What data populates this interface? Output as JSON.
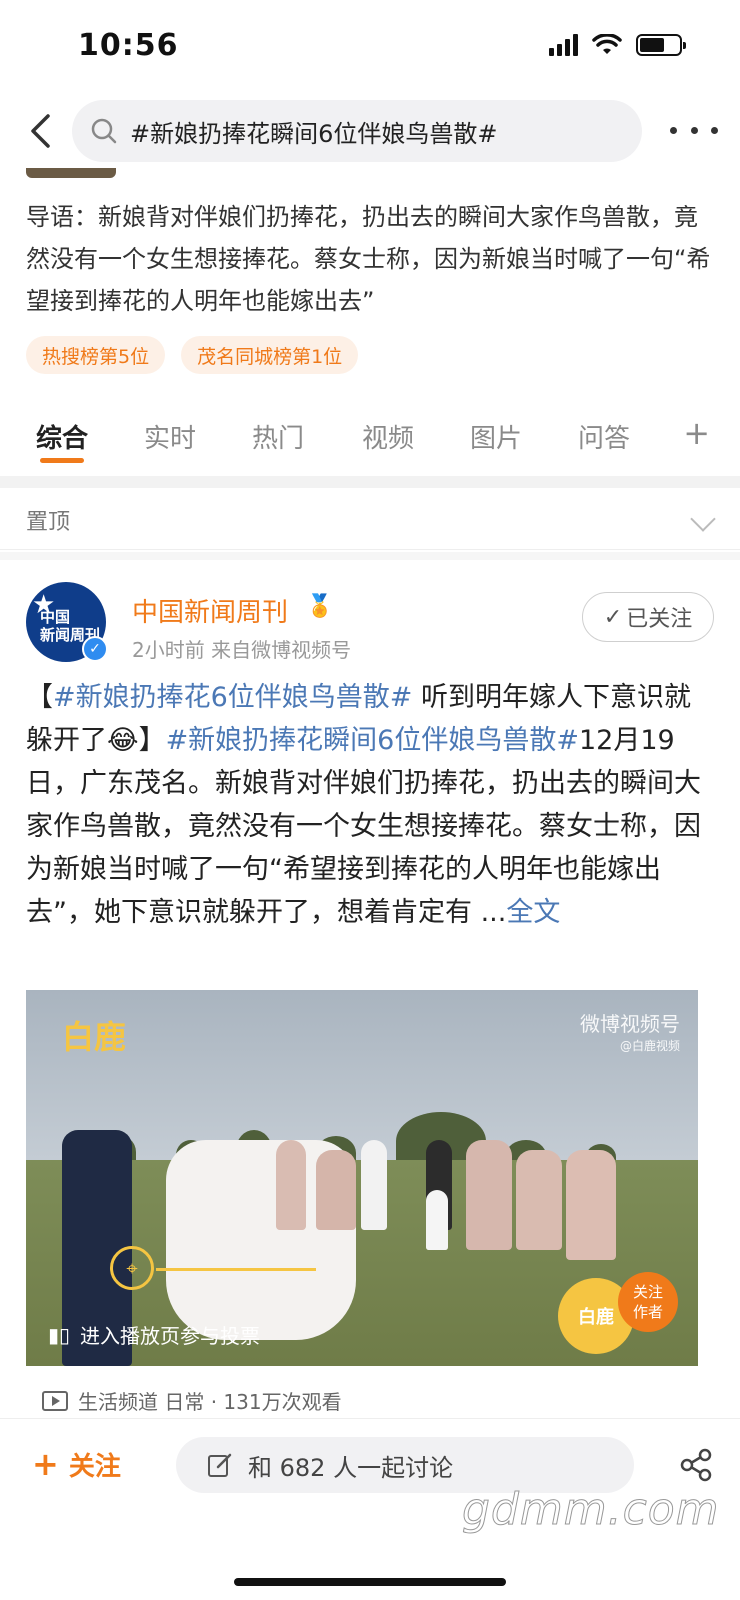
{
  "status_bar": {
    "time": "10:56"
  },
  "search": {
    "query": "#新娘扔捧花瞬间6位伴娘鸟兽散#"
  },
  "intro": {
    "text": "导语：新娘背对伴娘们扔捧花，扔出去的瞬间大家作鸟兽散，竟然没有一个女生想接捧花。蔡女士称，因为新娘当时喊了一句“希望接到捧花的人明年也能嫁出去”"
  },
  "tags": [
    "热搜榜第5位",
    "茂名同城榜第1位"
  ],
  "tabs": [
    "综合",
    "实时",
    "热门",
    "视频",
    "图片",
    "问答"
  ],
  "tabs_plus": "+",
  "pinned_label": "置顶",
  "post": {
    "avatar_text": "中国\n新闻周刊",
    "author": "中国新闻周刊",
    "meta": "2小时前  来自微博视频号",
    "follow_label": "已关注",
    "body": {
      "open": "【",
      "tag1": "#新娘扔捧花6位伴娘鸟兽散#",
      "seg1": " 听到明年嫁人下意识就躲开了",
      "emoji": "😂",
      "close": "】",
      "tag2": "#新娘扔捧花瞬间6位伴娘鸟兽散#",
      "seg2": "12月19日，广东茂名。新娘背对伴娘们扔捧花，扔出去的瞬间大家作鸟兽散，竟然没有一个女生想接捧花。蔡女士称，因为新娘当时喊了一句“希望接到捧花的人明年也能嫁出去”，她下意识就躲开了，想着肯定有 ...",
      "read_more": "全文"
    },
    "video": {
      "brand": "白鹿",
      "source": "微博视频号",
      "source_sub": "@白鹿视频",
      "vote_text": "进入播放页参与投票",
      "follow_author": "关注\n作者",
      "badge": "白鹿"
    },
    "video_meta": "生活频道 日常 · 131万次观看"
  },
  "bottom": {
    "follow": "关注",
    "discuss": "和 682 人一起讨论"
  },
  "watermark": "gdmm.com",
  "colors": {
    "accent": "#f07a1a",
    "link": "#4b78b5",
    "verified": "#2f8cf0"
  }
}
